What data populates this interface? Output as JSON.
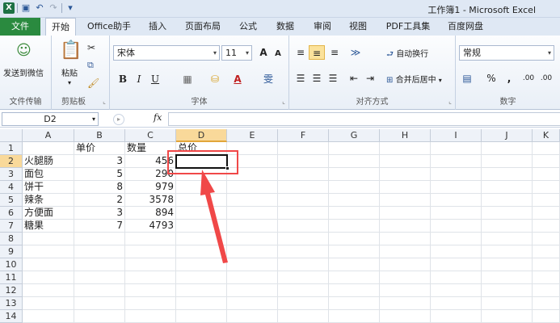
{
  "window": {
    "title": "工作簿1 - Microsoft Excel"
  },
  "quick_access": {
    "app_icon": "excel-icon",
    "items": [
      "save-icon",
      "undo-icon",
      "redo-icon",
      "customize-icon"
    ]
  },
  "tabs": [
    {
      "label": "文件"
    },
    {
      "label": "开始"
    },
    {
      "label": "Office助手"
    },
    {
      "label": "插入"
    },
    {
      "label": "页面布局"
    },
    {
      "label": "公式"
    },
    {
      "label": "数据"
    },
    {
      "label": "审阅"
    },
    {
      "label": "视图"
    },
    {
      "label": "PDF工具集"
    },
    {
      "label": "百度网盘"
    }
  ],
  "ribbon": {
    "wechat": {
      "button": "发送到微信",
      "group": "文件传输"
    },
    "clipboard": {
      "paste": "粘贴",
      "group": "剪贴板"
    },
    "font": {
      "name": "宋体",
      "size": "11",
      "group": "字体",
      "grow": "A",
      "shrink": "A",
      "bold": "B",
      "italic": "I",
      "underline": "U",
      "color_a": "A",
      "phonetic": "雯"
    },
    "alignment": {
      "wrap": "自动换行",
      "merge": "合并后居中",
      "group": "对齐方式"
    },
    "number": {
      "format": "常规",
      "percent": "%",
      "comma": ",",
      "inc": ".00",
      "dec": ".00",
      "group": "数字"
    }
  },
  "formula_bar": {
    "name_box": "D2",
    "fx": "fx",
    "content": ""
  },
  "sheet": {
    "columns": [
      "A",
      "B",
      "C",
      "D",
      "E",
      "F",
      "G",
      "H",
      "I",
      "J",
      "K"
    ],
    "rows": [
      "1",
      "2",
      "3",
      "4",
      "5",
      "6",
      "7",
      "8",
      "9",
      "10",
      "11",
      "12",
      "13",
      "14"
    ],
    "selected_cell": "D2",
    "cells": {
      "B1": "单价",
      "C1": "数量",
      "D1": "总价",
      "A2": "火腿肠",
      "B2": "3",
      "C2": "456",
      "A3": "面包",
      "B3": "5",
      "C3": "290",
      "A4": "饼干",
      "B4": "8",
      "C4": "979",
      "A5": "辣条",
      "B5": "2",
      "C5": "3578",
      "A6": "方便面",
      "B6": "3",
      "C6": "894",
      "A7": "糖果",
      "B7": "7",
      "C7": "4793"
    }
  },
  "annotation": {
    "color": "#f04848"
  }
}
